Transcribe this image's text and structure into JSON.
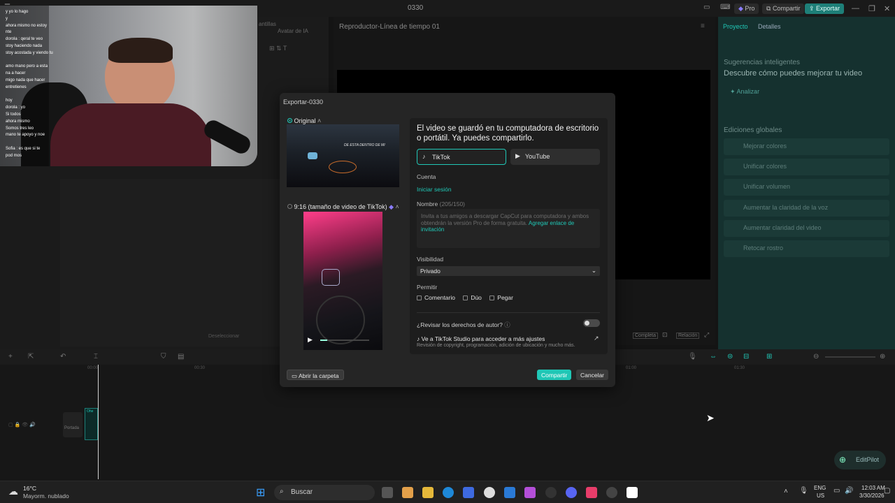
{
  "app": {
    "title": "0330",
    "pro": "Pro",
    "compartir": "Compartir",
    "exportar": "Exportar"
  },
  "left_toolbar": {
    "tab_plantillas": "antillas",
    "tab_avatar": "Avatar de IA"
  },
  "player": {
    "header": "Reproductor-Línea de tiempo 01",
    "completa": "Completa",
    "relacion": "Relación"
  },
  "right_panel": {
    "tab_proyecto": "Proyecto",
    "tab_detalles": "Detalles",
    "sugerencias": "Sugerencias inteligentes",
    "descubre": "Descubre cómo puedes mejorar tu video",
    "analizar": "Analizar",
    "ediciones": "Ediciones globales",
    "items": [
      "Mejorar colores",
      "Unificar colores",
      "Unificar volumen",
      "Aumentar la claridad de la voz",
      "Aumentar claridad del video",
      "Retocar rostro"
    ]
  },
  "timeline": {
    "t1": "00:00",
    "t2": "00:30",
    "t3": "01:00",
    "t4": "01:30",
    "portada": "Portada",
    "clip": "Ohe"
  },
  "webcam_chat": [
    "y yo lo hago",
    "y",
    "ahora mismo no estoy",
    "nte",
    "dorola : qeral te veo",
    "stoy haciendo nada",
    "stoy acostada y viendo tu",
    "",
    "amo mano pero a esta",
    "na a hacer",
    "migo nada que hacer",
    "entretienes",
    "",
    "hoy",
    "dorola : yo",
    "Si todos",
    "ahora mismo",
    "Somos tres leo",
    "mano te apoyo y noe",
    "",
    "Sofia : es que si te",
    "pod mos"
  ],
  "modal": {
    "title": "Exportar-0330",
    "original_label": "Original",
    "ratio_label": "9:16 (tamaño de video de TikTok)",
    "headline": "El video se guardó en tu computadora de escritorio o portátil. Ya puedes compartirlo.",
    "platforms": [
      "TikTok",
      "YouTube"
    ],
    "cuenta_label": "Cuenta",
    "iniciar_sesion": "Iniciar sesión",
    "nombre_label": "Nombre",
    "nombre_count": "(205/150)",
    "nombre_placeholder": "Invita a tus amigos a descargar CapCut para computadora y ambos obtendrán la versión Pro de forma gratuita.",
    "nombre_link": "Agregar enlace de invitación",
    "visibilidad_label": "Visibilidad",
    "visibilidad_value": "Privado",
    "permitir_label": "Permitir",
    "permitir_options": [
      "Comentario",
      "Dúo",
      "Pegar"
    ],
    "derechos": "¿Revisar los derechos de autor?",
    "studio_title": "Ve a TikTok Studio para acceder a más ajustes",
    "studio_sub": "Revisión de copyright, programación, adición de ubicación y mucho más.",
    "abrir_carpeta": "Abrir la carpeta",
    "compartir": "Compartir",
    "cancelar": "Cancelar",
    "thumb_overlay": "DE ESTA DENTRO DE MI"
  },
  "editpilot": "EditPilot",
  "taskbar": {
    "temp": "16°C",
    "weather": "Mayorm. nublado",
    "search": "Buscar",
    "lang1": "ENG",
    "lang2": "US",
    "time": "12:03 AM",
    "date": "3/30/2026"
  },
  "colors": {
    "accent": "#20c7b6",
    "export": "#1e7f78",
    "right_panel": "#15312f"
  }
}
